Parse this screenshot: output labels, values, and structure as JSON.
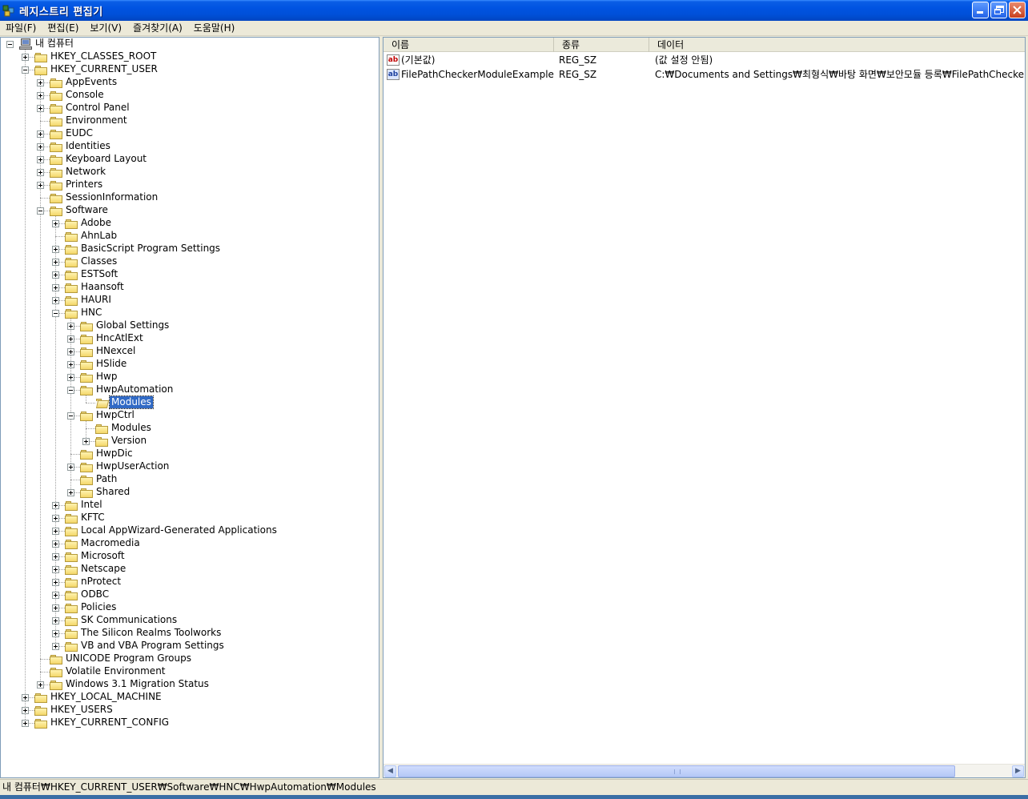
{
  "window": {
    "title": "레지스트리 편집기"
  },
  "menu": [
    "파일(F)",
    "편집(E)",
    "보기(V)",
    "즐겨찾기(A)",
    "도움말(H)"
  ],
  "tree": [
    {
      "level": 0,
      "label": "내 컴퓨터",
      "exp": "minus",
      "icon": "computer"
    },
    {
      "level": 1,
      "label": "HKEY_CLASSES_ROOT",
      "exp": "plus"
    },
    {
      "level": 1,
      "label": "HKEY_CURRENT_USER",
      "exp": "minus"
    },
    {
      "level": 2,
      "label": "AppEvents",
      "exp": "plus"
    },
    {
      "level": 2,
      "label": "Console",
      "exp": "plus"
    },
    {
      "level": 2,
      "label": "Control Panel",
      "exp": "plus"
    },
    {
      "level": 2,
      "label": "Environment",
      "exp": "none"
    },
    {
      "level": 2,
      "label": "EUDC",
      "exp": "plus"
    },
    {
      "level": 2,
      "label": "Identities",
      "exp": "plus"
    },
    {
      "level": 2,
      "label": "Keyboard Layout",
      "exp": "plus"
    },
    {
      "level": 2,
      "label": "Network",
      "exp": "plus"
    },
    {
      "level": 2,
      "label": "Printers",
      "exp": "plus"
    },
    {
      "level": 2,
      "label": "SessionInformation",
      "exp": "none"
    },
    {
      "level": 2,
      "label": "Software",
      "exp": "minus"
    },
    {
      "level": 3,
      "label": "Adobe",
      "exp": "plus"
    },
    {
      "level": 3,
      "label": "AhnLab",
      "exp": "none"
    },
    {
      "level": 3,
      "label": "BasicScript Program Settings",
      "exp": "plus"
    },
    {
      "level": 3,
      "label": "Classes",
      "exp": "plus"
    },
    {
      "level": 3,
      "label": "ESTSoft",
      "exp": "plus"
    },
    {
      "level": 3,
      "label": "Haansoft",
      "exp": "plus"
    },
    {
      "level": 3,
      "label": "HAURI",
      "exp": "plus"
    },
    {
      "level": 3,
      "label": "HNC",
      "exp": "minus"
    },
    {
      "level": 4,
      "label": "Global Settings",
      "exp": "plus"
    },
    {
      "level": 4,
      "label": "HncAtlExt",
      "exp": "plus"
    },
    {
      "level": 4,
      "label": "HNexcel",
      "exp": "plus"
    },
    {
      "level": 4,
      "label": "HSlide",
      "exp": "plus"
    },
    {
      "level": 4,
      "label": "Hwp",
      "exp": "plus"
    },
    {
      "level": 4,
      "label": "HwpAutomation",
      "exp": "minus"
    },
    {
      "level": 5,
      "label": "Modules",
      "exp": "none",
      "selected": true,
      "open": true
    },
    {
      "level": 4,
      "label": "HwpCtrl",
      "exp": "minus"
    },
    {
      "level": 5,
      "label": "Modules",
      "exp": "none"
    },
    {
      "level": 5,
      "label": "Version",
      "exp": "plus"
    },
    {
      "level": 4,
      "label": "HwpDic",
      "exp": "none"
    },
    {
      "level": 4,
      "label": "HwpUserAction",
      "exp": "plus"
    },
    {
      "level": 4,
      "label": "Path",
      "exp": "none"
    },
    {
      "level": 4,
      "label": "Shared",
      "exp": "plus"
    },
    {
      "level": 3,
      "label": "Intel",
      "exp": "plus"
    },
    {
      "level": 3,
      "label": "KFTC",
      "exp": "plus"
    },
    {
      "level": 3,
      "label": "Local AppWizard-Generated Applications",
      "exp": "plus"
    },
    {
      "level": 3,
      "label": "Macromedia",
      "exp": "plus"
    },
    {
      "level": 3,
      "label": "Microsoft",
      "exp": "plus"
    },
    {
      "level": 3,
      "label": "Netscape",
      "exp": "plus"
    },
    {
      "level": 3,
      "label": "nProtect",
      "exp": "plus"
    },
    {
      "level": 3,
      "label": "ODBC",
      "exp": "plus"
    },
    {
      "level": 3,
      "label": "Policies",
      "exp": "plus"
    },
    {
      "level": 3,
      "label": "SK Communications",
      "exp": "plus"
    },
    {
      "level": 3,
      "label": "The Silicon Realms Toolworks",
      "exp": "plus"
    },
    {
      "level": 3,
      "label": "VB and VBA Program Settings",
      "exp": "plus"
    },
    {
      "level": 2,
      "label": "UNICODE Program Groups",
      "exp": "none"
    },
    {
      "level": 2,
      "label": "Volatile Environment",
      "exp": "none"
    },
    {
      "level": 2,
      "label": "Windows 3.1 Migration Status",
      "exp": "plus"
    },
    {
      "level": 1,
      "label": "HKEY_LOCAL_MACHINE",
      "exp": "plus"
    },
    {
      "level": 1,
      "label": "HKEY_USERS",
      "exp": "plus"
    },
    {
      "level": 1,
      "label": "HKEY_CURRENT_CONFIG",
      "exp": "plus"
    }
  ],
  "list": {
    "columns": [
      "이름",
      "종류",
      "데이터"
    ],
    "rows": [
      {
        "name": "(기본값)",
        "type": "REG_SZ",
        "data": "(값 설정 안됨)",
        "icon": "ab-red"
      },
      {
        "name": "FilePathCheckerModuleExample",
        "type": "REG_SZ",
        "data": "C:₩Documents and Settings₩최형식₩바탕 화면₩보안모듈 등록₩FilePathChecker",
        "icon": "ab-blue"
      }
    ]
  },
  "status": {
    "path": "내 컴퓨터₩HKEY_CURRENT_USER₩Software₩HNC₩HwpAutomation₩Modules"
  },
  "icons": {
    "value_icon": "ab",
    "scroll_left": "◀",
    "scroll_right": "▶"
  }
}
